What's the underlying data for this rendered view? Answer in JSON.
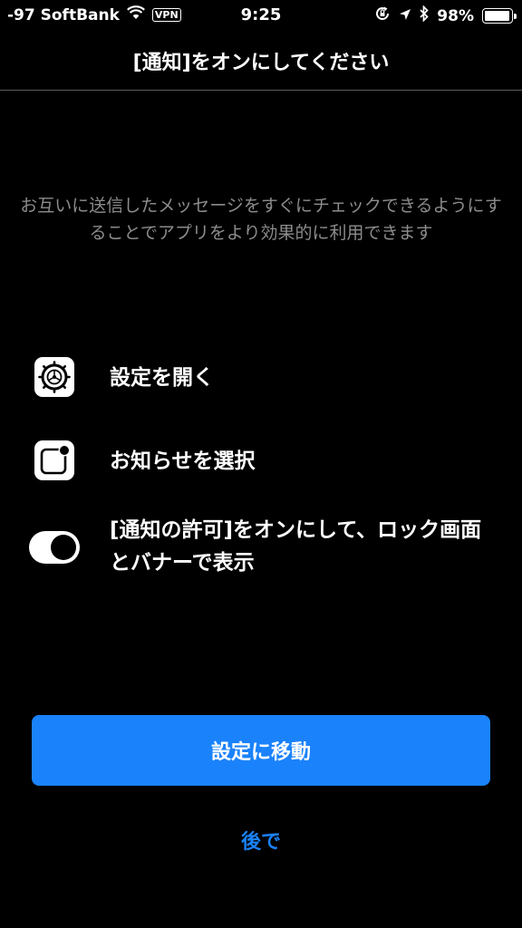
{
  "status_bar": {
    "carrier": "-97 SoftBank",
    "vpn": "VPN",
    "time": "9:25",
    "battery": "98%",
    "battery_level": 0.98
  },
  "header": {
    "title": "[通知]をオンにしてください"
  },
  "description": "お互いに送信したメッセージをすぐにチェックできるようにすることでアプリをより効果的に利用できます",
  "steps": [
    {
      "icon": "settings-gear-icon",
      "label": "設定を開く"
    },
    {
      "icon": "notification-badge-icon",
      "label": "お知らせを選択"
    },
    {
      "icon": "toggle-switch-icon",
      "label": "[通知の許可]をオンにして、ロック画面とバナーで表示"
    }
  ],
  "actions": {
    "primary_label": "設定に移動",
    "secondary_label": "後で"
  },
  "colors": {
    "accent": "#1a82fb",
    "background": "#000000",
    "muted_text": "#8c8c8c"
  }
}
